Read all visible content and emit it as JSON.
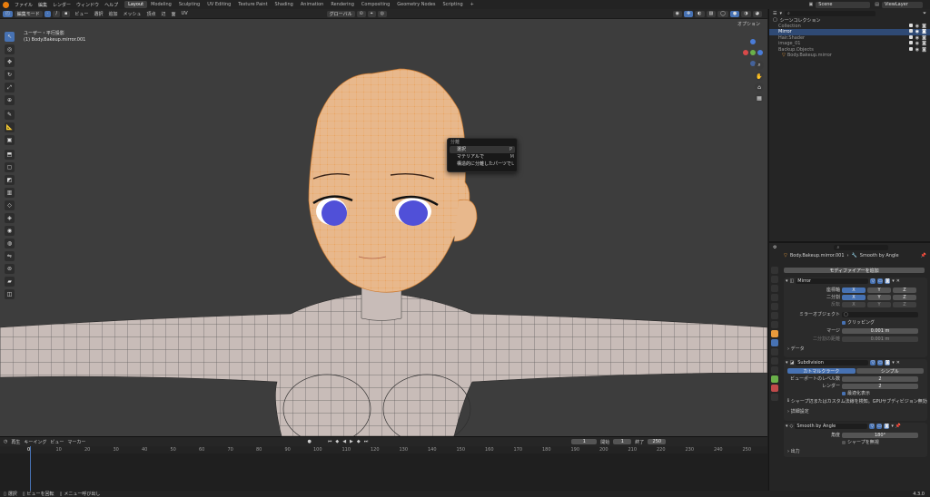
{
  "topbar": {
    "menus": [
      "ファイル",
      "編集",
      "レンダー",
      "ウィンドウ",
      "ヘルプ"
    ],
    "workspaces": [
      "Layout",
      "Modeling",
      "Sculpting",
      "UV Editing",
      "Texture Paint",
      "Shading",
      "Animation",
      "Rendering",
      "Compositing",
      "Geometry Nodes",
      "Scripting"
    ],
    "workspace_add": "+",
    "scene_label": "Scene",
    "viewlayer_label": "ViewLayer"
  },
  "viewport_header": {
    "mode": "編集モード",
    "menus": [
      "ビュー",
      "選択",
      "追加",
      "メッシュ",
      "頂点",
      "辺",
      "面",
      "UV"
    ],
    "orientation": "グローバル",
    "options": "オプション"
  },
  "viewport": {
    "view_name": "ユーザー・平行投影",
    "object_info": "(1) Body.Bakeup.mirror.001"
  },
  "context_menu": {
    "title": "分離",
    "items": [
      {
        "label": "選択",
        "shortcut": "P"
      },
      {
        "label": "マテリアルで",
        "shortcut": "M"
      },
      {
        "label": "構造的に分離したパーツで",
        "shortcut": "L"
      }
    ]
  },
  "outliner": {
    "search_placeholder": "",
    "root": "シーンコレクション",
    "items": [
      {
        "label": "Collection",
        "selected": false
      },
      {
        "label": "Mirror",
        "selected": true
      },
      {
        "label": "Hair.Shader",
        "selected": false
      },
      {
        "label": "image_01",
        "selected": false
      },
      {
        "label": "Backup.Objects",
        "selected": false
      },
      {
        "label": "Body.Bakeup.mirror",
        "selected": false
      }
    ]
  },
  "properties": {
    "object_name": "Body.Bakeup.mirror.001",
    "modifier_tab": "Smooth by Angle",
    "add_modifier": "モディファイアーを追加",
    "mirror": {
      "name": "Mirror",
      "axis_label": "座標軸",
      "bisect_label": "二分割",
      "flip_label": "反転",
      "axes": [
        "X",
        "Y",
        "Z"
      ],
      "mirror_object_label": "ミラーオブジェクト",
      "clipping_label": "クリッピング",
      "merge_label": "マージ",
      "merge_value": "0.001 m",
      "bisect_distance_label": "二分割の距離",
      "bisect_distance_value": "0.001 m",
      "data_label": "データ"
    },
    "subdivision": {
      "name": "Subdivision",
      "catmull": "カトマルクラーク",
      "simple": "シンプル",
      "viewport_label": "ビューポートのレベル数",
      "viewport_value": "2",
      "render_label": "レンダー",
      "render_value": "2",
      "optimal_label": "最適化表示",
      "warning": "シャープ辺またはカスタム法線を検知。GPUサブディビジョン無効",
      "advanced": "詳細設定"
    },
    "smooth": {
      "name": "Smooth by Angle",
      "angle_label": "角度",
      "angle_value": "180°",
      "sharp_label": "シャープを無視",
      "output": "出力"
    }
  },
  "timeline": {
    "menus": [
      "再生",
      "キーイング",
      "ビュー",
      "マーカー"
    ],
    "current_frame": "1",
    "start_label": "開始",
    "start": "1",
    "end_label": "終了",
    "end": "250",
    "ticks": [
      "0",
      "10",
      "20",
      "30",
      "40",
      "50",
      "60",
      "70",
      "80",
      "90",
      "100",
      "110",
      "120",
      "130",
      "140",
      "150",
      "160",
      "170",
      "180",
      "190",
      "200",
      "210",
      "220",
      "230",
      "240",
      "250"
    ]
  },
  "status": {
    "select": "選択",
    "rotate": "ビューを回転",
    "menu": "メニュー呼び出し",
    "version": "4.3.0"
  },
  "colors": {
    "accent": "#4772b3",
    "wire_orange": "#e89a3c",
    "skin": "#e8b88c",
    "body": "#c8bcb8",
    "eye": "#5050d8"
  }
}
